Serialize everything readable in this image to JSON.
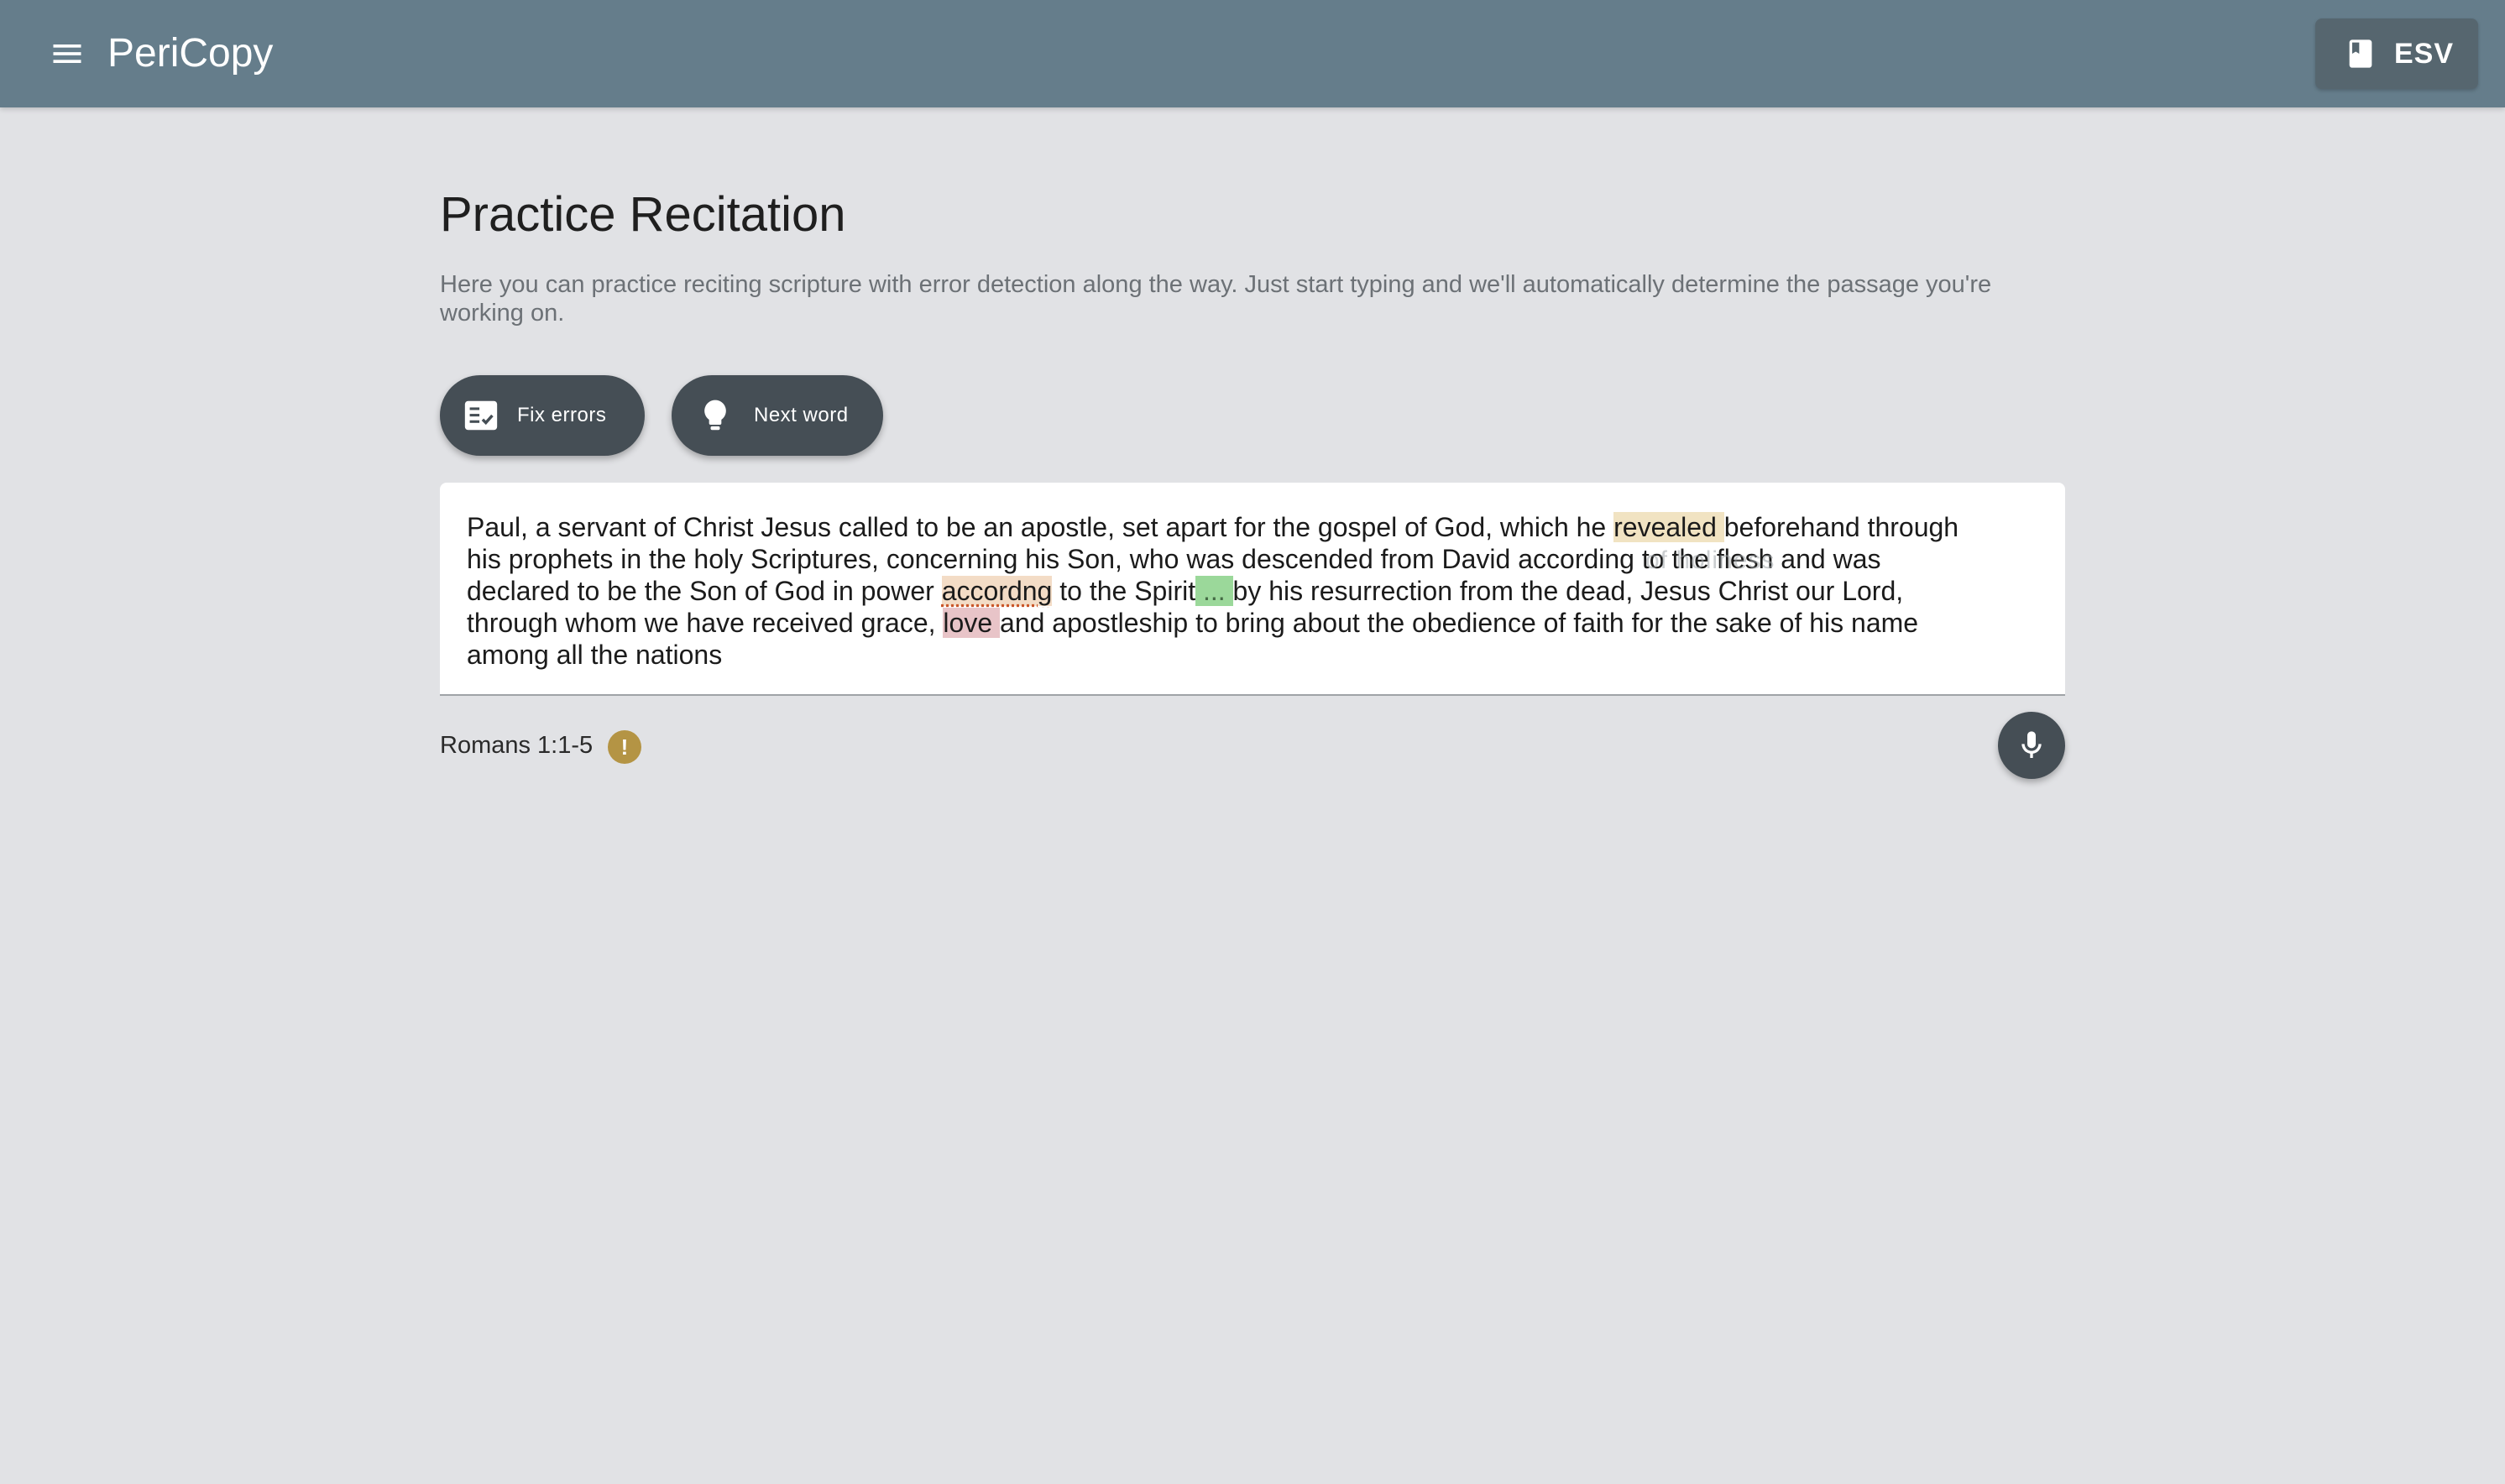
{
  "app": {
    "title": "PeriCopy",
    "version_label": "ESV"
  },
  "page": {
    "title": "Practice Recitation",
    "description": "Here you can practice reciting scripture with error detection along the way. Just start typing and we'll automatically determine the passage you're working on."
  },
  "actions": {
    "fix_errors_label": "Fix errors",
    "next_word_label": "Next word"
  },
  "recitation": {
    "lines": [
      {
        "before": "Paul, a servant of Christ Jesus called to be an apostle, set apart for the gospel of God, which he ",
        "highlight": "revealed ",
        "after": "beforehand through"
      },
      {
        "text": "his prophets in the holy Scriptures, concerning his Son, who was descended from David according to the flesh and was"
      },
      {
        "before": "declared to be the Son of God in power ",
        "error_word": "accordng",
        "middle": " to the Spirit",
        "skip_marker": " ... ",
        "after": "by his resurrection from the dead, Jesus Christ our Lord,"
      },
      {
        "before": "through whom we have received grace, ",
        "wrong_word": "love ",
        "after": "and apostleship to bring about the obedience of faith for the sake of his name"
      },
      {
        "text": "among all the nations"
      }
    ],
    "ghost_hint": "of holiness"
  },
  "status": {
    "reference": "Romans 1:1-5",
    "warning_symbol": "!"
  },
  "icons": {
    "menu": "menu-icon",
    "book": "book-icon",
    "checklist": "checklist-icon",
    "lightbulb": "lightbulb-icon",
    "mic": "mic-icon"
  },
  "colors": {
    "topbar": "#657d8b",
    "background": "#e1e2e5",
    "pill": "#454e55",
    "highlight_yellow": "#f1e3c2",
    "highlight_error": "#f3dcc6",
    "highlight_green": "#9bd89a",
    "highlight_red": "#e8c4c8",
    "warning": "#b49444"
  }
}
